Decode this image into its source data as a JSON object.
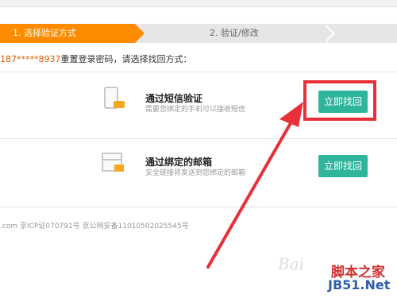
{
  "steps": {
    "step1": "1. 选择验证方式",
    "step2": "2. 验证/修改"
  },
  "prompt": {
    "phone": "187*****8937",
    "text": "重置登录密码，请选择找回方式："
  },
  "methods": [
    {
      "title": "通过短信验证",
      "desc": "需要您绑定的手机可以接收短信",
      "button": "立即找回",
      "icon": "phone-sms-icon"
    },
    {
      "title": "通过绑定的邮箱",
      "desc": "安全链接将发送到您绑定的邮箱",
      "button": "立即找回",
      "icon": "mail-icon"
    }
  ],
  "footer": ".com 京ICP证070791号 京公网安备11010502025545号",
  "watermark": {
    "line1": "脚本之家",
    "line2": "JB51.Net",
    "line3": "Bai"
  },
  "colors": {
    "step_active": "#ff8b00",
    "button": "#2fb59a",
    "highlight": "#e8303a",
    "phone_text": "#e05a00"
  }
}
